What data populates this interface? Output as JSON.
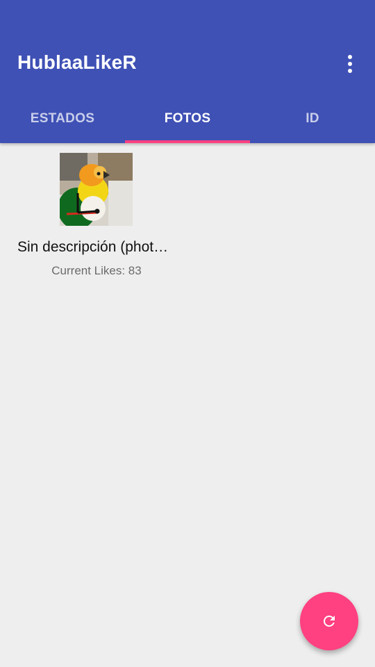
{
  "app": {
    "title": "HublaaLikeR",
    "overflow_icon": "more-vert-icon"
  },
  "tabs": [
    {
      "label": "ESTADOS",
      "active": false
    },
    {
      "label": "FOTOS",
      "active": true
    },
    {
      "label": "ID",
      "active": false
    }
  ],
  "colors": {
    "primary": "#3f51b5",
    "accent": "#ff4081",
    "background": "#eeeeee"
  },
  "photos": [
    {
      "caption": "Sin descripción (phot…",
      "likes_text": "Current Likes: 83",
      "thumbnail_icon": "parrot-photo"
    }
  ],
  "fab": {
    "icon": "refresh-icon"
  }
}
